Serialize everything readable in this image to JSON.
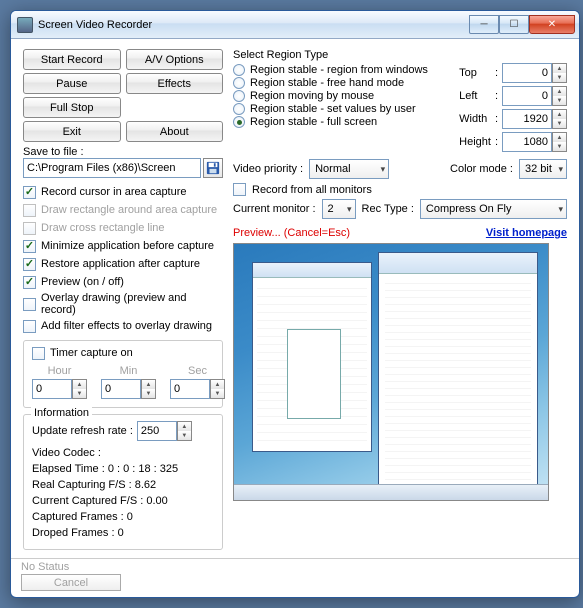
{
  "window": {
    "title": "Screen Video Recorder"
  },
  "buttons": {
    "start": "Start Record",
    "pause": "Pause",
    "fullstop": "Full Stop",
    "exit": "Exit",
    "avoptions": "A/V Options",
    "effects": "Effects",
    "about": "About"
  },
  "save": {
    "label": "Save to file :",
    "path": "C:\\Program Files (x86)\\Screen"
  },
  "checks": {
    "cursor": "Record cursor in area capture",
    "drawrect": "Draw rectangle around area capture",
    "drawcross": "Draw cross rectangle line",
    "minapp": "Minimize application before capture",
    "restoreapp": "Restore application after capture",
    "preview": "Preview (on / off)",
    "overlay": "Overlay drawing (preview and record)",
    "filter": "Add filter effects to overlay drawing"
  },
  "timer": {
    "title": "Timer capture on",
    "hour_lbl": "Hour",
    "min_lbl": "Min",
    "sec_lbl": "Sec",
    "hour": "0",
    "min": "0",
    "sec": "0"
  },
  "info": {
    "title": "Information",
    "refresh_lbl": "Update refresh rate :",
    "refresh": "250",
    "codec": "Video Codec :",
    "elapsed": "Elapsed Time :  0 : 0 : 18 : 325",
    "realfs": "Real Capturing F/S :  8.62",
    "curfs": "Current Captured F/S :  0.00",
    "capframes": "Captured Frames :  0",
    "dropframes": "Droped Frames :  0"
  },
  "region": {
    "header": "Select Region Type",
    "r1": "Region stable - region from windows",
    "r2": "Region stable - free hand mode",
    "r3": "Region moving by mouse",
    "r4": "Region stable - set values by user",
    "r5": "Region stable - full screen"
  },
  "dims": {
    "top_lbl": "Top",
    "top": "0",
    "left_lbl": "Left",
    "left": "0",
    "width_lbl": "Width",
    "width": "1920",
    "height_lbl": "Height",
    "height": "1080"
  },
  "video": {
    "priority_lbl": "Video priority :",
    "priority": "Normal",
    "colormode_lbl": "Color mode :",
    "colormode": "32 bit",
    "recall": "Record from all monitors",
    "curmon_lbl": "Current monitor :",
    "curmon": "2",
    "rectype_lbl": "Rec Type :",
    "rectype": "Compress On Fly"
  },
  "preview": {
    "label": "Preview... (Cancel=Esc)",
    "link": "Visit homepage"
  },
  "status": {
    "text": "No Status",
    "cancel": "Cancel"
  }
}
